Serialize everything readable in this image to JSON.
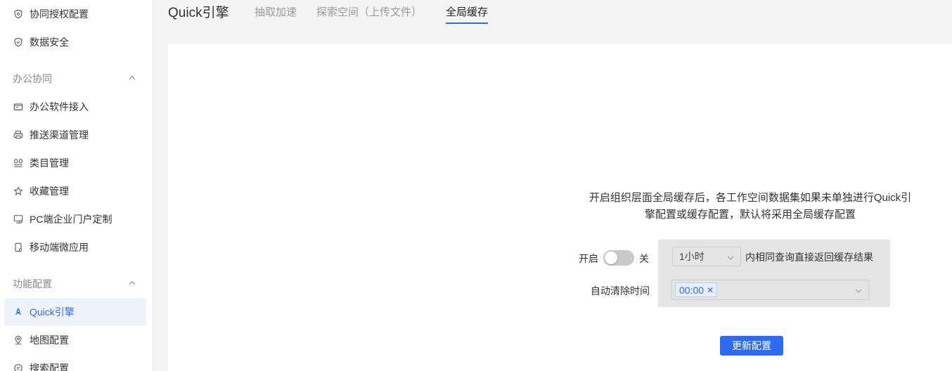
{
  "sidebar": {
    "items_top": [
      {
        "label": "协同授权配置",
        "icon": "shield-check-icon"
      },
      {
        "label": "数据安全",
        "icon": "shield-icon"
      }
    ],
    "group_office": {
      "label": "办公协同",
      "icon": "chevron-up-icon"
    },
    "items_office": [
      {
        "label": "办公软件接入",
        "icon": "folder-icon"
      },
      {
        "label": "推送渠道管理",
        "icon": "printer-icon"
      },
      {
        "label": "类目管理",
        "icon": "category-icon"
      },
      {
        "label": "收藏管理",
        "icon": "star-icon"
      },
      {
        "label": "PC端企业门户定制",
        "icon": "monitor-icon"
      },
      {
        "label": "移动端微应用",
        "icon": "mobile-icon"
      }
    ],
    "group_feature": {
      "label": "功能配置",
      "icon": "chevron-up-icon"
    },
    "items_feature": [
      {
        "label": "Quick引擎",
        "icon": "rocket-icon",
        "active": true
      },
      {
        "label": "地图配置",
        "icon": "map-pin-icon"
      },
      {
        "label": "搜索配置",
        "icon": "search-icon"
      }
    ]
  },
  "header": {
    "brand": "Quick引擎",
    "tabs": [
      {
        "label": "抽取加速"
      },
      {
        "label": "探索空间（上传文件）"
      },
      {
        "label": "全局缓存",
        "active": true
      }
    ]
  },
  "main": {
    "description_line1": "开启组织层面全局缓存后，各工作空间数据集如果未单独进行Quick引",
    "description_line2": "擎配置或缓存配置，默认将采用全局缓存配置",
    "switch_on_label": "开启",
    "switch_off_label": "关",
    "switch_state": false,
    "period_value": "1小时",
    "period_suffix": "内相同查询直接返回缓存结果",
    "clear_label": "自动清除时间",
    "clear_times": [
      "00:00"
    ],
    "update_button": "更新配置"
  },
  "colors": {
    "accent": "#2f6bf0",
    "sidebar_active_bg": "#eef2fb",
    "page_bg": "#f4f4f4",
    "settings_bg": "#e5e5e5"
  }
}
